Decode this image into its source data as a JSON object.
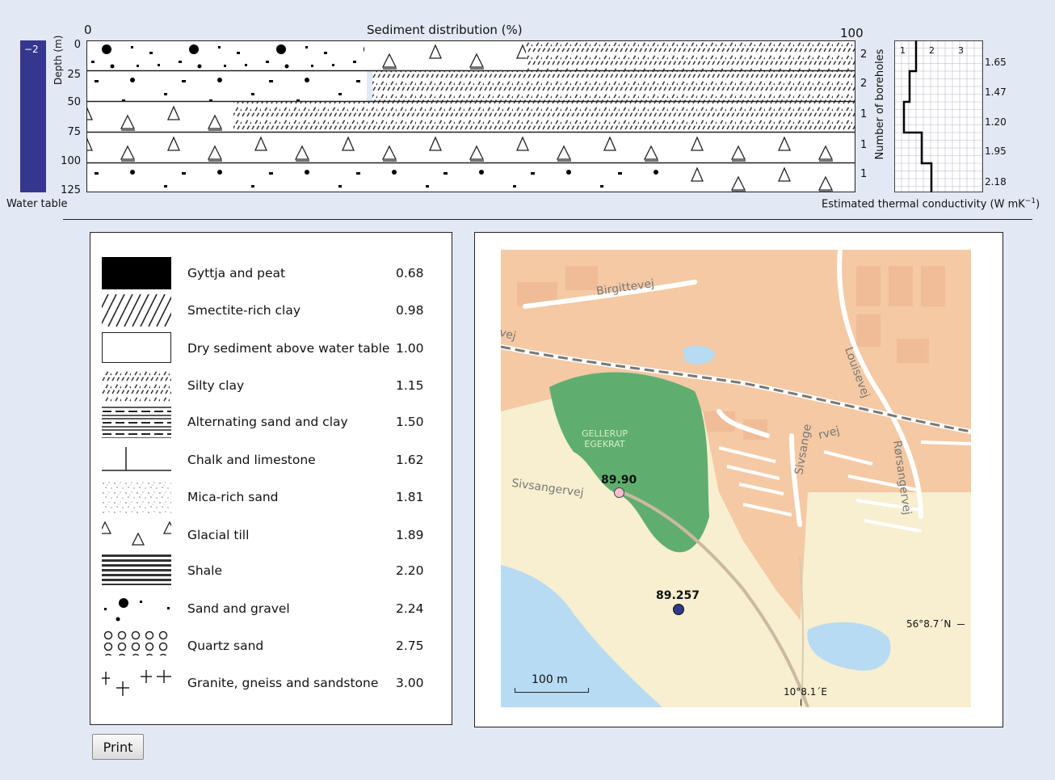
{
  "header": {
    "sediment_title": "Sediment distribution (%)",
    "x_min": "0",
    "x_max": "100",
    "depth_label": "Depth (m)",
    "boreholes_label": "Number of boreholes",
    "water_table_value": "−2",
    "water_table_label": "Water table",
    "conductivity_label": "Estimated thermal conductivity (W mK",
    "conductivity_sup": "−1",
    "conductivity_close": ")"
  },
  "depth_ticks": [
    "0",
    "25",
    "50",
    "75",
    "100",
    "125"
  ],
  "borehole_counts": [
    "2",
    "2",
    "1",
    "1",
    "1"
  ],
  "conductivity_axis": [
    "1",
    "2",
    "3"
  ],
  "conductivity_values": [
    "1.65",
    "1.47",
    "1.20",
    "1.95",
    "2.18"
  ],
  "legend": [
    {
      "label": "Gyttja and peat",
      "value": "0.68",
      "pattern": "black"
    },
    {
      "label": "Smectite-rich clay",
      "value": "0.98",
      "pattern": "smectite"
    },
    {
      "label": "Dry sediment above water table",
      "value": "1.00",
      "pattern": "white"
    },
    {
      "label": "Silty clay",
      "value": "1.15",
      "pattern": "silty"
    },
    {
      "label": "Alternating sand and clay",
      "value": "1.50",
      "pattern": "alternating"
    },
    {
      "label": "Chalk and limestone",
      "value": "1.62",
      "pattern": "chalk"
    },
    {
      "label": "Mica-rich sand",
      "value": "1.81",
      "pattern": "mica"
    },
    {
      "label": "Glacial till",
      "value": "1.89",
      "pattern": "till"
    },
    {
      "label": "Shale",
      "value": "2.20",
      "pattern": "shale"
    },
    {
      "label": "Sand and gravel",
      "value": "2.24",
      "pattern": "gravel"
    },
    {
      "label": "Quartz sand",
      "value": "2.75",
      "pattern": "quartz"
    },
    {
      "label": "Granite, gneiss and sandstone",
      "value": "3.00",
      "pattern": "granite"
    }
  ],
  "map": {
    "streets": [
      "Birgittevej",
      "vej",
      "Louisevej",
      "Sivsangervej",
      "Sivsange",
      "rvej",
      "Rørsangervej"
    ],
    "forest_label_1": "GELLERUP",
    "forest_label_2": "EGEKRAT",
    "point_1": "89.90",
    "point_2": "89.257",
    "scale": "100 m",
    "lat": "56°8.7´N",
    "lon": "10°8.1´E",
    "point_1_color": "#f3bfcf",
    "point_2_color": "#2e3a8c"
  },
  "colors": {
    "background": "#e2e8f4",
    "water_table": "#35378f",
    "urban": "#f4c9a3",
    "forest": "#5fae70",
    "sand": "#f7efcf",
    "water": "#b7dbf2"
  },
  "print_label": "Print"
}
